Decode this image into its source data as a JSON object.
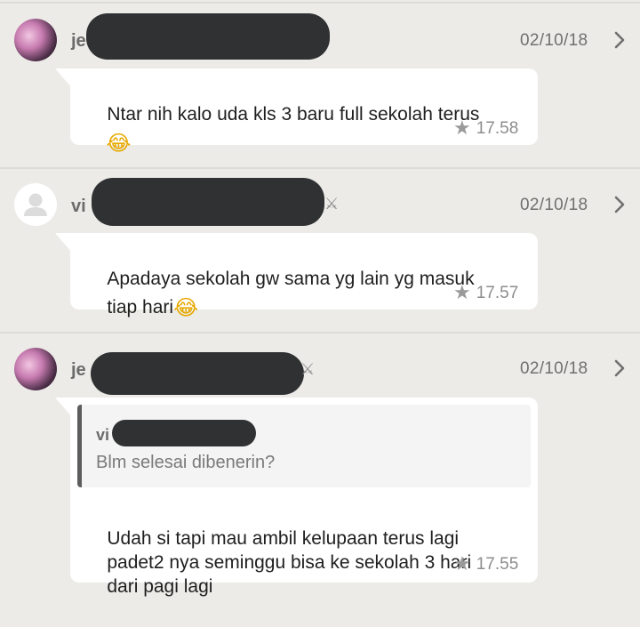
{
  "messages": [
    {
      "avatar": "profile-photo",
      "sender_initial": "je",
      "date": "02/10/18",
      "text_line1": "Ntar nih kalo uda kls 3 baru full sekolah terus",
      "text_line2": "",
      "emoji": "😂",
      "time": "17.58"
    },
    {
      "avatar": "default-user-icon",
      "sender_initial": "vi",
      "date": "02/10/18",
      "text_line1": "Apadaya sekolah gw sama yg lain yg masuk",
      "text_line2": "tiap hari",
      "emoji": "😂",
      "time": "17.57",
      "badge": "⚔"
    },
    {
      "avatar": "profile-photo",
      "sender_initial": "je",
      "date": "02/10/18",
      "quote": {
        "sender_initial": "vi",
        "text": "Blm selesai dibenerin?"
      },
      "text_line1": "Udah si tapi mau ambil kelupaan terus lagi",
      "text_line2": "padet2 nya seminggu bisa ke sekolah 3 hari",
      "text_line3": "dari pagi lagi",
      "time": "17.55",
      "badge": "⚔"
    }
  ],
  "colors": {
    "background": "#ecebe7",
    "bubble": "#ffffff",
    "redaction": "#2f3133"
  }
}
